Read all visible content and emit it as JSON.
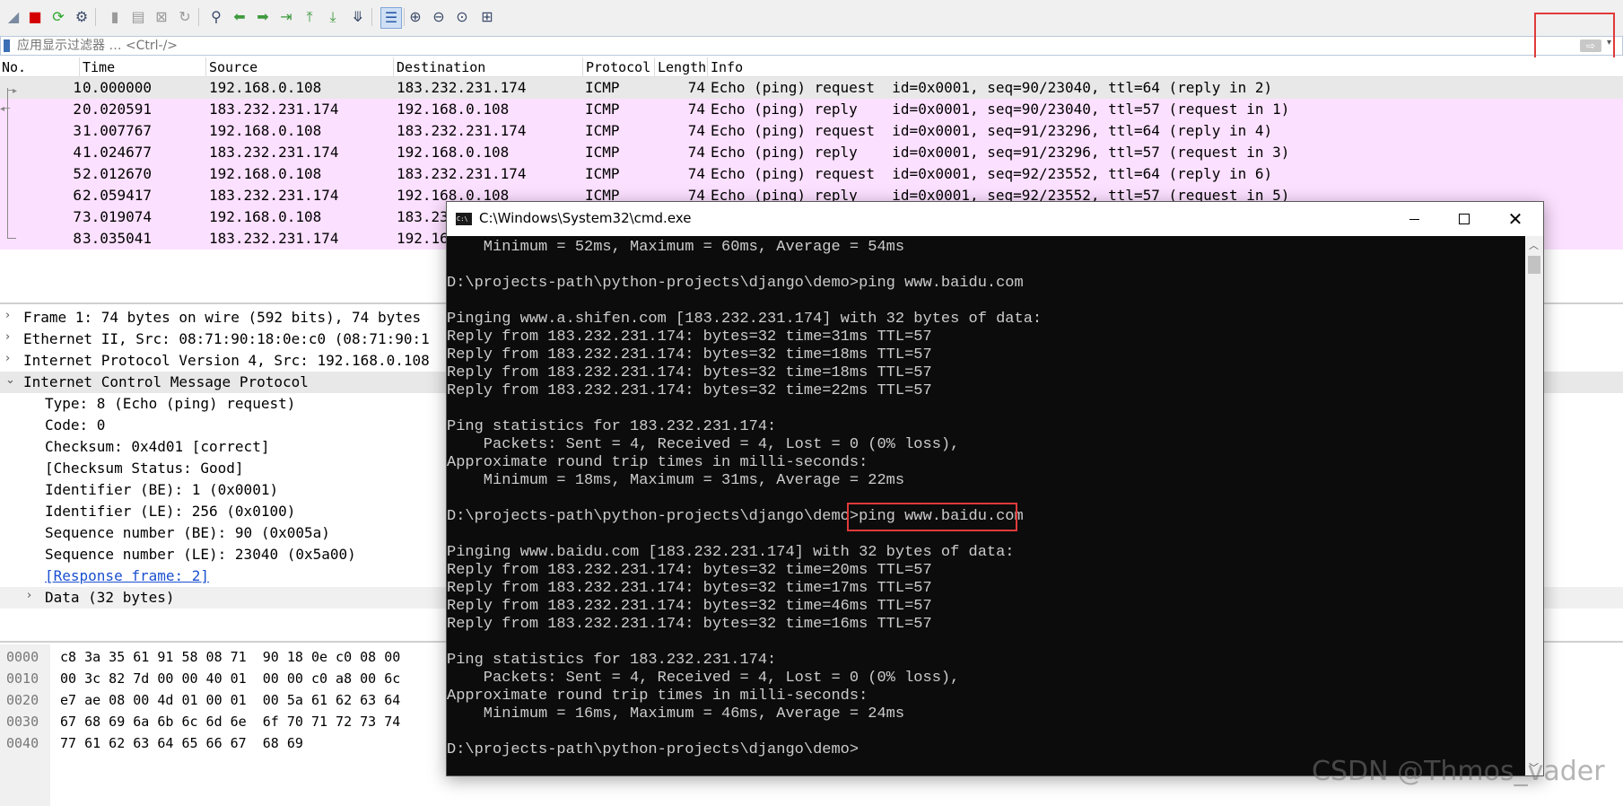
{
  "toolbar": {
    "icons": [
      "shark-fin-icon",
      "stop-icon",
      "restart-icon",
      "options-gear-icon",
      "open-file-icon",
      "save-file-icon",
      "close-file-icon",
      "reload-icon",
      "find-icon",
      "go-back-icon",
      "go-forward-icon",
      "go-to-packet-icon",
      "first-packet-icon",
      "last-packet-icon",
      "autoscroll-icon",
      "colorize-icon",
      "zoom-in-icon",
      "zoom-out-icon",
      "zoom-normal-icon",
      "resize-columns-icon"
    ],
    "colors": {
      "stop": "#d40000",
      "restart": "#2aa62a",
      "shark": "#7a8aa0"
    }
  },
  "filter": {
    "placeholder": "应用显示过滤器 … <Ctrl-/>"
  },
  "packet_list": {
    "columns": [
      "No.",
      "Time",
      "Source",
      "Destination",
      "Protocol",
      "Length",
      "Info"
    ],
    "rows": [
      {
        "no": "1",
        "time": "0.000000",
        "src": "192.168.0.108",
        "dst": "183.232.231.174",
        "proto": "ICMP",
        "len": "74",
        "info": "Echo (ping) request  id=0x0001, seq=90/23040, ttl=64 (reply in 2)"
      },
      {
        "no": "2",
        "time": "0.020591",
        "src": "183.232.231.174",
        "dst": "192.168.0.108",
        "proto": "ICMP",
        "len": "74",
        "info": "Echo (ping) reply    id=0x0001, seq=90/23040, ttl=57 (request in 1)"
      },
      {
        "no": "3",
        "time": "1.007767",
        "src": "192.168.0.108",
        "dst": "183.232.231.174",
        "proto": "ICMP",
        "len": "74",
        "info": "Echo (ping) request  id=0x0001, seq=91/23296, ttl=64 (reply in 4)"
      },
      {
        "no": "4",
        "time": "1.024677",
        "src": "183.232.231.174",
        "dst": "192.168.0.108",
        "proto": "ICMP",
        "len": "74",
        "info": "Echo (ping) reply    id=0x0001, seq=91/23296, ttl=57 (request in 3)"
      },
      {
        "no": "5",
        "time": "2.012670",
        "src": "192.168.0.108",
        "dst": "183.232.231.174",
        "proto": "ICMP",
        "len": "74",
        "info": "Echo (ping) request  id=0x0001, seq=92/23552, ttl=64 (reply in 6)"
      },
      {
        "no": "6",
        "time": "2.059417",
        "src": "183.232.231.174",
        "dst": "192.168.0.108",
        "proto": "ICMP",
        "len": "74",
        "info": "Echo (ping) reply    id=0x0001, seq=92/23552, ttl=57 (request in 5)"
      },
      {
        "no": "7",
        "time": "3.019074",
        "src": "192.168.0.108",
        "dst": "183.23",
        "proto": "",
        "len": "",
        "info": ""
      },
      {
        "no": "8",
        "time": "3.035041",
        "src": "183.232.231.174",
        "dst": "192.16",
        "proto": "",
        "len": "",
        "info": ""
      }
    ],
    "colors": {
      "selected": "#e8e8e8",
      "icmp": "#fce0ff"
    }
  },
  "detail_tree": [
    {
      "text": "Frame 1: 74 bytes on wire (592 bits), 74 bytes",
      "arrow": ">"
    },
    {
      "text": "Ethernet II, Src: 08:71:90:18:0e:c0 (08:71:90:1",
      "arrow": ">"
    },
    {
      "text": "Internet Protocol Version 4, Src: 192.168.0.108",
      "arrow": ">"
    },
    {
      "text": "Internet Control Message Protocol",
      "arrow": "v"
    },
    {
      "text": "Type: 8 (Echo (ping) request)",
      "arrow": ""
    },
    {
      "text": "Code: 0",
      "arrow": ""
    },
    {
      "text": "Checksum: 0x4d01 [correct]",
      "arrow": ""
    },
    {
      "text": "[Checksum Status: Good]",
      "arrow": ""
    },
    {
      "text": "Identifier (BE): 1 (0x0001)",
      "arrow": ""
    },
    {
      "text": "Identifier (LE): 256 (0x0100)",
      "arrow": ""
    },
    {
      "text": "Sequence number (BE): 90 (0x005a)",
      "arrow": ""
    },
    {
      "text": "Sequence number (LE): 23040 (0x5a00)",
      "arrow": ""
    },
    {
      "text": "[Response frame: 2]",
      "arrow": ""
    },
    {
      "text": "Data (32 bytes)",
      "arrow": ">"
    }
  ],
  "hex_dump": [
    {
      "offset": "0000",
      "bytes": "c8 3a 35 61 91 58 08 71  90 18 0e c0 08 00"
    },
    {
      "offset": "0010",
      "bytes": "00 3c 82 7d 00 00 40 01  00 00 c0 a8 00 6c"
    },
    {
      "offset": "0020",
      "bytes": "e7 ae 08 00 4d 01 00 01  00 5a 61 62 63 64"
    },
    {
      "offset": "0030",
      "bytes": "67 68 69 6a 6b 6c 6d 6e  6f 70 71 72 73 74"
    },
    {
      "offset": "0040",
      "bytes": "77 61 62 63 64 65 66 67  68 69"
    }
  ],
  "cmd": {
    "title": "C:\\Windows\\System32\\cmd.exe",
    "icon_text": "C:\\",
    "lines": [
      "    Minimum = 52ms, Maximum = 60ms, Average = 54ms",
      "",
      "D:\\projects-path\\python-projects\\django\\demo>ping www.baidu.com",
      "",
      "Pinging www.a.shifen.com [183.232.231.174] with 32 bytes of data:",
      "Reply from 183.232.231.174: bytes=32 time=31ms TTL=57",
      "Reply from 183.232.231.174: bytes=32 time=18ms TTL=57",
      "Reply from 183.232.231.174: bytes=32 time=18ms TTL=57",
      "Reply from 183.232.231.174: bytes=32 time=22ms TTL=57",
      "",
      "Ping statistics for 183.232.231.174:",
      "    Packets: Sent = 4, Received = 4, Lost = 0 (0% loss),",
      "Approximate round trip times in milli-seconds:",
      "    Minimum = 18ms, Maximum = 31ms, Average = 22ms",
      "",
      "D:\\projects-path\\python-projects\\django\\demo>ping www.baidu.com",
      "",
      "Pinging www.baidu.com [183.232.231.174] with 32 bytes of data:",
      "Reply from 183.232.231.174: bytes=32 time=20ms TTL=57",
      "Reply from 183.232.231.174: bytes=32 time=17ms TTL=57",
      "Reply from 183.232.231.174: bytes=32 time=46ms TTL=57",
      "Reply from 183.232.231.174: bytes=32 time=16ms TTL=57",
      "",
      "Ping statistics for 183.232.231.174:",
      "    Packets: Sent = 4, Received = 4, Lost = 0 (0% loss),",
      "Approximate round trip times in milli-seconds:",
      "    Minimum = 16ms, Maximum = 46ms, Average = 24ms",
      "",
      "D:\\projects-path\\python-projects\\django\\demo>"
    ],
    "colors": {
      "bg": "#0c0c0c",
      "fg": "#cccccc"
    }
  },
  "highlight_color": "#e03a3a",
  "watermark": "CSDN @Thmos_vader"
}
